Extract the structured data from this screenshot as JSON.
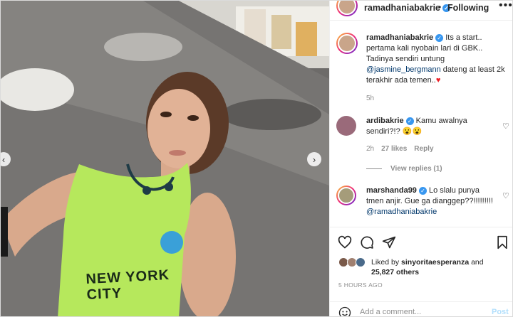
{
  "post": {
    "author": "ramadhaniabakrie",
    "follow_dot": "•",
    "follow_status": "Following",
    "more": "•••",
    "caption_author": "ramadhaniabakrie",
    "caption_text_1": " Its a start.. pertama kali nyobain lari di GBK.. Tadinya sendiri untung ",
    "caption_mention": "@jasmine_bergmann",
    "caption_text_2": " dateng at least 2k terakhir ada temen..",
    "caption_emoji": "♥",
    "caption_time": "5h"
  },
  "photo": {
    "shirt_text": "NEW YORK CITY"
  },
  "comments": [
    {
      "author": "ardibakrie",
      "text": " Kamu awalnya sendiri?!? 😮😮",
      "time": "2h",
      "likes": "27 likes",
      "reply": "Reply",
      "view_replies": "View replies (1)"
    },
    {
      "author": "marshanda99",
      "text": " Lo slalu punya tmen anjir. Gue ga dianggep??!!!!!!!!!",
      "mention": "@ramadhaniabakrie"
    }
  ],
  "likes": {
    "prefix": "Liked by ",
    "user": "sinyoritaesperanza",
    "and": " and ",
    "count": "25,827 others"
  },
  "posted_time": "5 HOURS AGO",
  "add_comment": {
    "placeholder": "Add a comment...",
    "post_label": "Post"
  },
  "colors": {
    "accent": "#3897f0",
    "link": "#00376b",
    "muted": "#8e8e8e",
    "post_disabled": "#b2dffc"
  }
}
